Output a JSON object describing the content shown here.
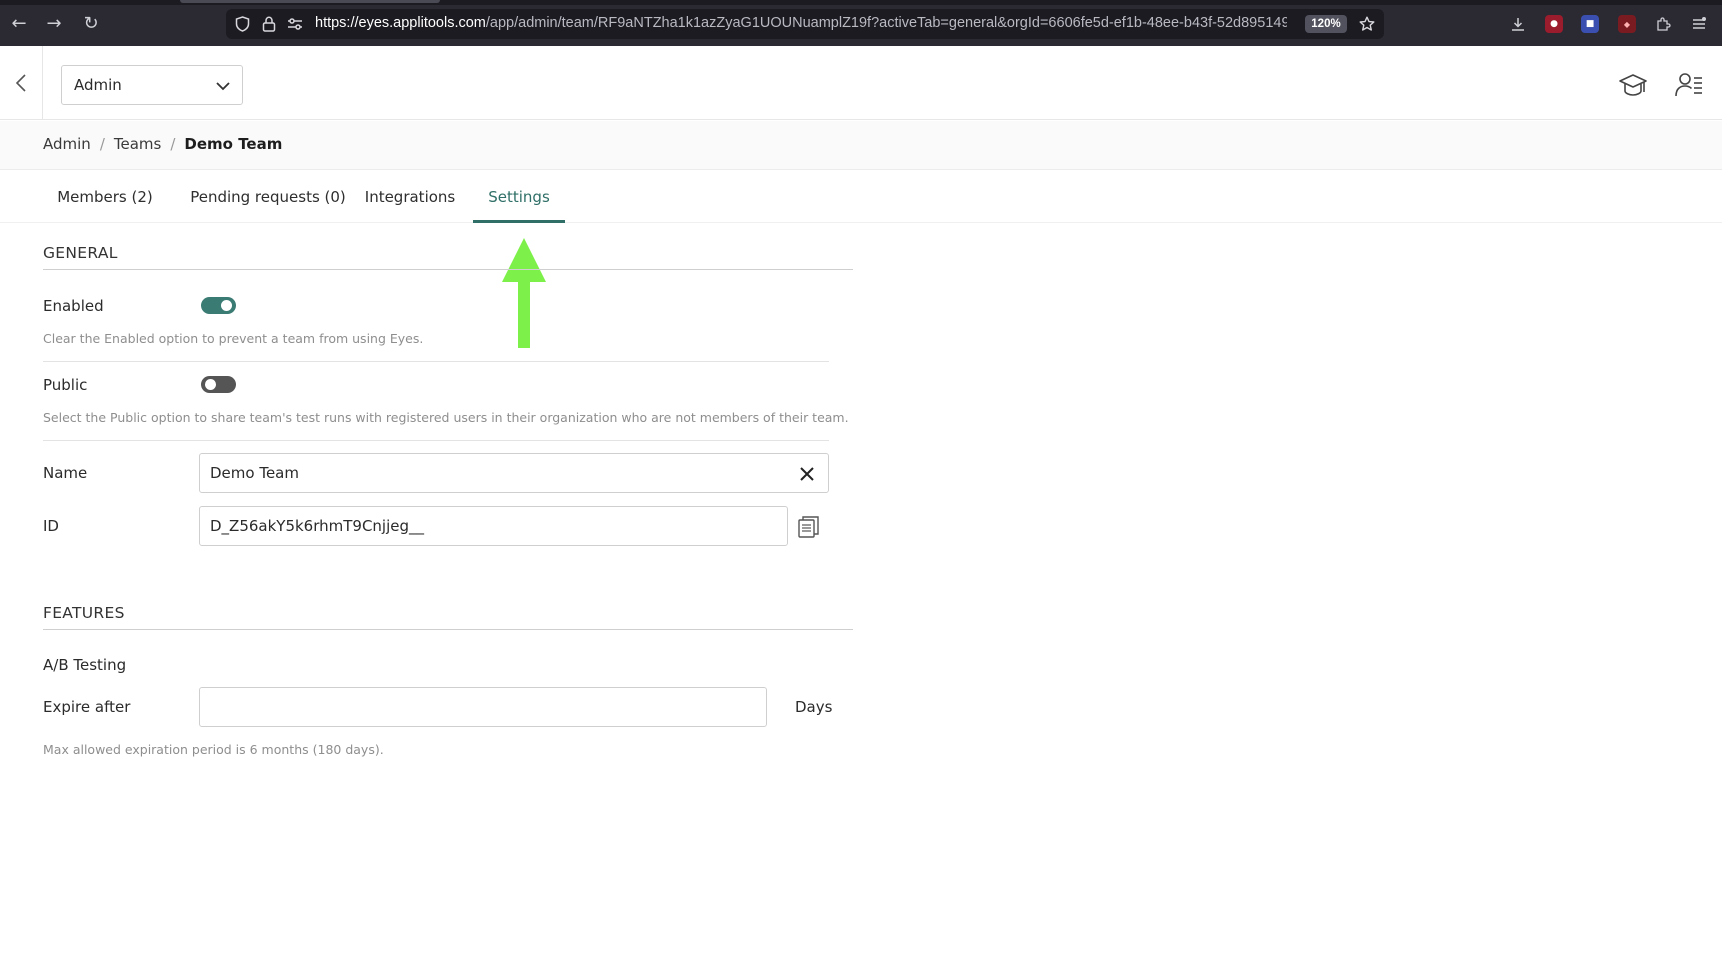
{
  "browser": {
    "url_host": "https://eyes.applitools.com",
    "url_path": "/app/admin/team/RF9aNTZha1k1azZyaG1UOUNuamplZ19f?activeTab=general&orgId=6606fe5d-ef1b-48ee-b43f-52d895149",
    "zoom": "120%"
  },
  "header": {
    "org_select": "Admin"
  },
  "breadcrumb": {
    "items": [
      "Admin",
      "Teams",
      "Demo Team"
    ],
    "separator": "/"
  },
  "tabs": [
    {
      "label": "Members (2)",
      "active": false
    },
    {
      "label": "Pending requests (0)",
      "active": false
    },
    {
      "label": "Integrations",
      "active": false
    },
    {
      "label": "Settings",
      "active": true
    }
  ],
  "general": {
    "title": "GENERAL",
    "enabled": {
      "label": "Enabled",
      "on": true,
      "help": "Clear the Enabled option to prevent a team from using Eyes."
    },
    "public": {
      "label": "Public",
      "on": false,
      "help": "Select the Public option to share team's test runs with registered users in their organization who are not members of their team."
    },
    "name": {
      "label": "Name",
      "value": "Demo Team"
    },
    "id": {
      "label": "ID",
      "value": "D_Z56akY5k6rhmT9Cnjjeg__"
    }
  },
  "features": {
    "title": "FEATURES",
    "ab_testing": "A/B Testing",
    "expire_after": {
      "label": "Expire after",
      "value": "",
      "unit": "Days",
      "help": "Max allowed expiration period is 6 months (180 days)."
    }
  },
  "colors": {
    "accent": "#2f6f67",
    "toggle_on": "#3a7b73",
    "toggle_off": "#555555",
    "annotation_arrow": "#7ef04a"
  }
}
